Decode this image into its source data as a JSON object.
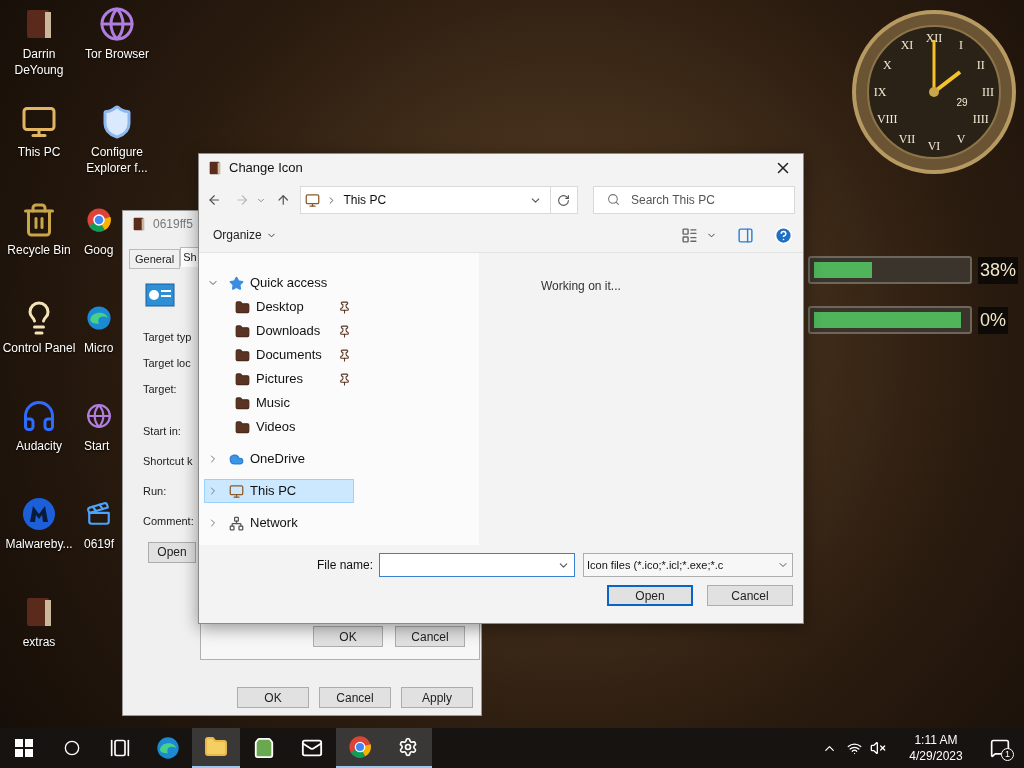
{
  "desktop_icons": [
    {
      "label": "Darrin DeYoung",
      "kind": "book",
      "partial": false
    },
    {
      "label": "Tor Browser",
      "kind": "globe",
      "partial": false
    },
    {
      "label": "This PC",
      "kind": "computer",
      "partial": false
    },
    {
      "label": "Configure Explorer f...",
      "kind": "shield",
      "partial": false
    },
    {
      "label": "Recycle Bin",
      "kind": "bin",
      "partial": false
    },
    {
      "label": "Goog",
      "kind": "browser",
      "partial": true
    },
    {
      "label": "Control Panel",
      "kind": "lamp",
      "partial": false
    },
    {
      "label": "Micro",
      "kind": "wave",
      "partial": true
    },
    {
      "label": "Audacity",
      "kind": "headphones",
      "partial": false
    },
    {
      "label": "Start",
      "kind": "globe",
      "partial": true
    },
    {
      "label": "Malwareby...",
      "kind": "mlogo",
      "partial": false
    },
    {
      "label": "0619f",
      "kind": "video",
      "partial": true
    },
    {
      "label": "extras",
      "kind": "book",
      "partial": false
    }
  ],
  "clock": {
    "numerals": [
      "XII",
      "XI",
      "I",
      "X",
      "II",
      "IX",
      "III",
      "VIII",
      "IIII",
      "VII",
      "V",
      "VI"
    ],
    "date": "29"
  },
  "drives": [
    {
      "level": 0.38,
      "reading": "38%"
    },
    {
      "level": 0.97,
      "reading": "0%"
    }
  ],
  "properties_window": {
    "title": "0619ff5",
    "tabs": [
      {
        "label": "General",
        "selected": false
      },
      {
        "label": "Sh",
        "selected": true
      }
    ],
    "target_fields": [
      "Target typ",
      "Target loc",
      "Target:"
    ],
    "shortcut_fields": [
      "Start in:",
      "Shortcut k",
      "Run:",
      "Comment:"
    ],
    "open_button": "Open",
    "buttons": [
      "OK",
      "Cancel",
      "Apply"
    ]
  },
  "icon_dialog_behind": {
    "buttons": [
      "OK",
      "Cancel"
    ]
  },
  "change_icon_dialog": {
    "title": "Change Icon",
    "address": "This PC",
    "search_placeholder": "Search This PC",
    "organize": "Organize",
    "status": "Working on it...",
    "tree": [
      {
        "label": "Quick access",
        "kind": "star",
        "expanded": true,
        "selected": false,
        "children": [
          {
            "label": "Desktop",
            "pinned": true,
            "selected": false
          },
          {
            "label": "Downloads",
            "pinned": true,
            "selected": false
          },
          {
            "label": "Documents",
            "pinned": true,
            "selected": false
          },
          {
            "label": "Pictures",
            "pinned": true,
            "selected": false
          },
          {
            "label": "Music",
            "pinned": false,
            "selected": false
          },
          {
            "label": "Videos",
            "pinned": false,
            "selected": false
          }
        ]
      },
      {
        "label": "OneDrive",
        "kind": "cloud",
        "expanded": false,
        "selected": false
      },
      {
        "label": "This PC",
        "kind": "computer",
        "expanded": false,
        "selected": true
      },
      {
        "label": "Network",
        "kind": "network",
        "expanded": false,
        "selected": false
      }
    ],
    "file_name_label": "File name:",
    "filter": "Icon files (*.ico;*.icl;*.exe;*.c",
    "buttons": [
      {
        "label": "Open",
        "default": true
      },
      {
        "label": "Cancel",
        "default": false
      }
    ]
  },
  "taskbar": {
    "items": [
      {
        "kind": "start",
        "active": false
      },
      {
        "kind": "search",
        "active": false
      },
      {
        "kind": "taskview",
        "active": false
      },
      {
        "kind": "edge",
        "active": false
      },
      {
        "kind": "explorer",
        "active": true
      },
      {
        "kind": "store",
        "active": false
      },
      {
        "kind": "mail",
        "active": false
      },
      {
        "kind": "chrome",
        "active": true
      },
      {
        "kind": "settings",
        "active": true
      }
    ],
    "time": "1:11 AM",
    "date": "4/29/2023",
    "notifications": "1"
  }
}
